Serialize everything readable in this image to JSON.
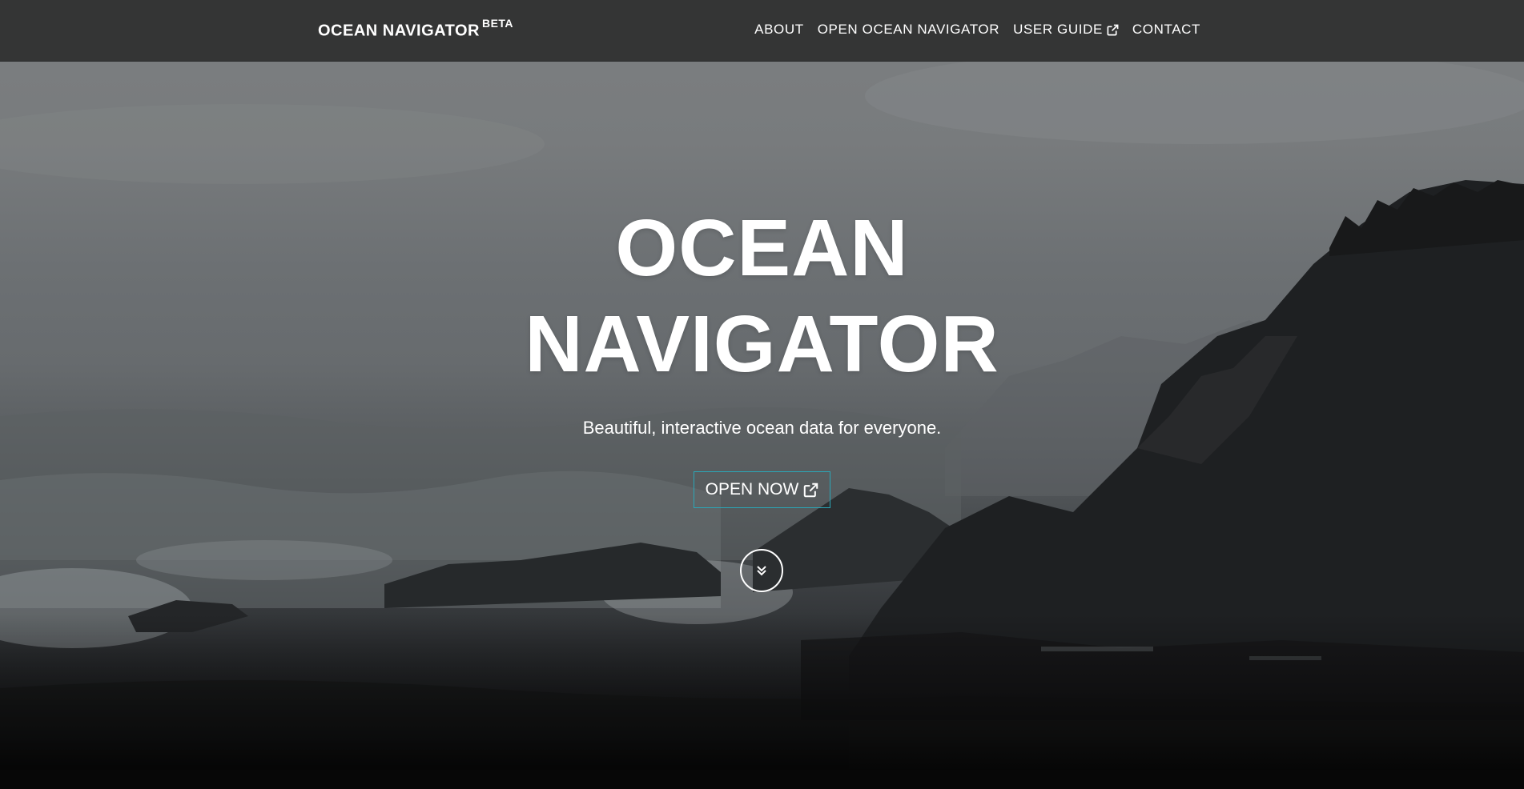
{
  "navbar": {
    "brand": "OCEAN NAVIGATOR",
    "brand_badge": "BETA",
    "links": [
      {
        "label": "ABOUT",
        "icon": null
      },
      {
        "label": "OPEN OCEAN NAVIGATOR",
        "icon": null
      },
      {
        "label": "USER GUIDE",
        "icon": "external-link-icon"
      },
      {
        "label": "CONTACT",
        "icon": null
      }
    ]
  },
  "hero": {
    "title_line1": "OCEAN",
    "title_line2": "NAVIGATOR",
    "subtitle": "Beautiful, interactive ocean data for everyone.",
    "cta_label": "OPEN NOW",
    "cta_icon": "external-link-icon",
    "scroll_icon": "double-chevron-down-icon",
    "background": "stormy-sea-cliffs-photo"
  },
  "colors": {
    "navbar_bg": "#343535",
    "text": "#ffffff",
    "cta_border": "#2aa7b8"
  }
}
